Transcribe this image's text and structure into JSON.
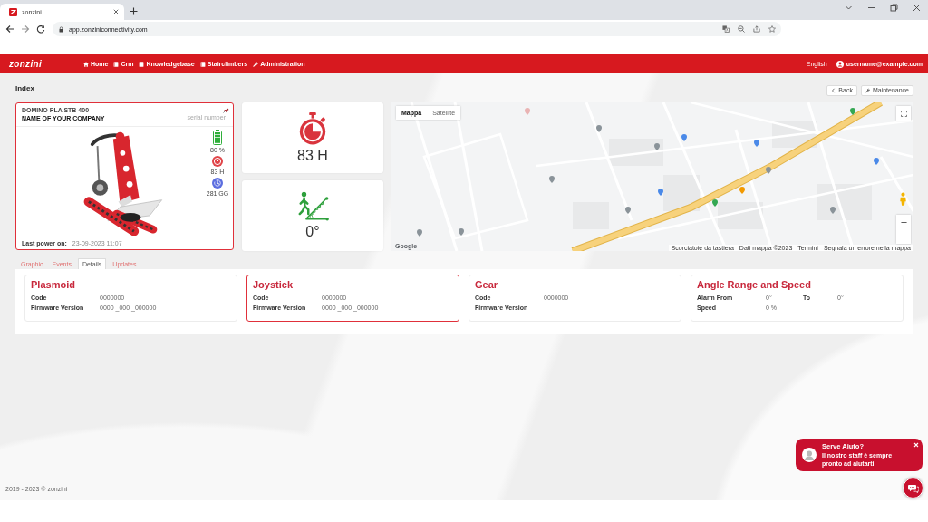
{
  "browser": {
    "tab_title": "zonzini",
    "url": "app.zonziniconnectivity.com"
  },
  "nav": {
    "logo": "zonzini",
    "items": [
      {
        "label": "Home",
        "kind": "home"
      },
      {
        "label": "Crm",
        "kind": "book"
      },
      {
        "label": "Knowledgebase",
        "kind": "book"
      },
      {
        "label": "Stairclimbers",
        "kind": "book"
      },
      {
        "label": "Administration",
        "kind": "wrench"
      }
    ],
    "language": "English",
    "user": "username@example.com"
  },
  "page": {
    "title": "Index",
    "buttons": [
      {
        "label": "Back",
        "kind": "back"
      },
      {
        "label": "Maintenance",
        "kind": "maintenance"
      }
    ]
  },
  "device": {
    "model": "DOMINO PLA STB 400",
    "company": "NAME OF YOUR COMPANY",
    "serial_number": "serial number",
    "selected": true,
    "stats": [
      {
        "kind": "battery",
        "value": "80 %"
      },
      {
        "kind": "hours",
        "value": "83 H"
      },
      {
        "kind": "days",
        "value": "281 GG"
      }
    ],
    "last_power_on": {
      "label": "Last power on:",
      "value": "23-09-2023 11:07"
    }
  },
  "counters": [
    {
      "kind": "hours",
      "value": "83 H"
    },
    {
      "kind": "angle",
      "value": "0°"
    }
  ],
  "map": {
    "types": [
      {
        "label": "Mappa",
        "selected": true
      },
      {
        "label": "Satellite",
        "selected": false
      }
    ],
    "logo": "Google",
    "attribution": [
      "Scorciatoie da tastiera",
      "Dati mappa ©2023",
      "Termini",
      "Segnala un errore nella mappa"
    ]
  },
  "tabs": [
    {
      "label": "Graphic",
      "selected": false
    },
    {
      "label": "Events",
      "selected": false
    },
    {
      "label": "Details",
      "selected": true
    },
    {
      "label": "Updates",
      "selected": false
    }
  ],
  "modules": [
    {
      "title": "Plasmoid",
      "selected": false,
      "rows": [
        {
          "fields": [
            {
              "label": "Code",
              "value": "0000000"
            }
          ]
        },
        {
          "fields": [
            {
              "label": "Firmware Version",
              "value": "0000 _000 _000000"
            }
          ]
        }
      ]
    },
    {
      "title": "Joystick",
      "selected": true,
      "rows": [
        {
          "fields": [
            {
              "label": "Code",
              "value": "0000000"
            }
          ]
        },
        {
          "fields": [
            {
              "label": "Firmware Version",
              "value": "0000 _000 _000000"
            }
          ]
        }
      ]
    },
    {
      "title": "Gear",
      "selected": false,
      "rows": [
        {
          "fields": [
            {
              "label": "Code",
              "value": "0000000"
            }
          ]
        },
        {
          "fields": [
            {
              "label": "Firmware Version"
            }
          ]
        }
      ]
    },
    {
      "title": "Angle Range and Speed",
      "selected": false,
      "rows": [
        {
          "fields": [
            {
              "label": "Alarm From",
              "value": "0°"
            },
            {
              "label": "To",
              "value": "0°"
            }
          ]
        },
        {
          "fields": [
            {
              "label": "Speed",
              "value": "0 %"
            }
          ]
        }
      ]
    }
  ],
  "footer": {
    "copyright": "2019 - 2023 © zonzini"
  },
  "chat": {
    "title": "Serve Aiuto?",
    "message": "Il nostro staff è sempre pronto ad aiutarti"
  }
}
